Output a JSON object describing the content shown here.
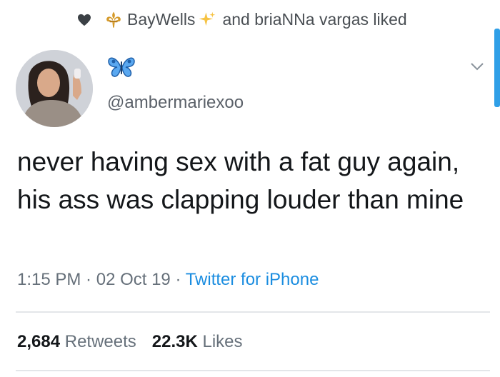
{
  "social_context": {
    "user1": "BayWells",
    "connector": "and",
    "user2": "briaNNa vargas",
    "action": "liked",
    "icons": [
      "heart-icon",
      "fleur-de-lis-icon",
      "sparkle-icon"
    ]
  },
  "author": {
    "display_icon": "butterfly-icon",
    "handle": "@ambermariexoo"
  },
  "tweet": {
    "text": "never having sex with a fat guy again, his ass was clapping louder than mine"
  },
  "meta": {
    "time": "1:15 PM",
    "sep1": " · ",
    "date": "02 Oct 19",
    "sep2": " · ",
    "source": "Twitter for iPhone"
  },
  "stats": {
    "retweets_count": "2,684",
    "retweets_label": "Retweets",
    "likes_count": "22.3K",
    "likes_label": "Likes"
  },
  "colors": {
    "accent": "#1b8de0",
    "butterfly": "#3b82d6",
    "heart": "#3b4045",
    "fleur": "#d59a2a",
    "sparkle": "#f6c343"
  }
}
